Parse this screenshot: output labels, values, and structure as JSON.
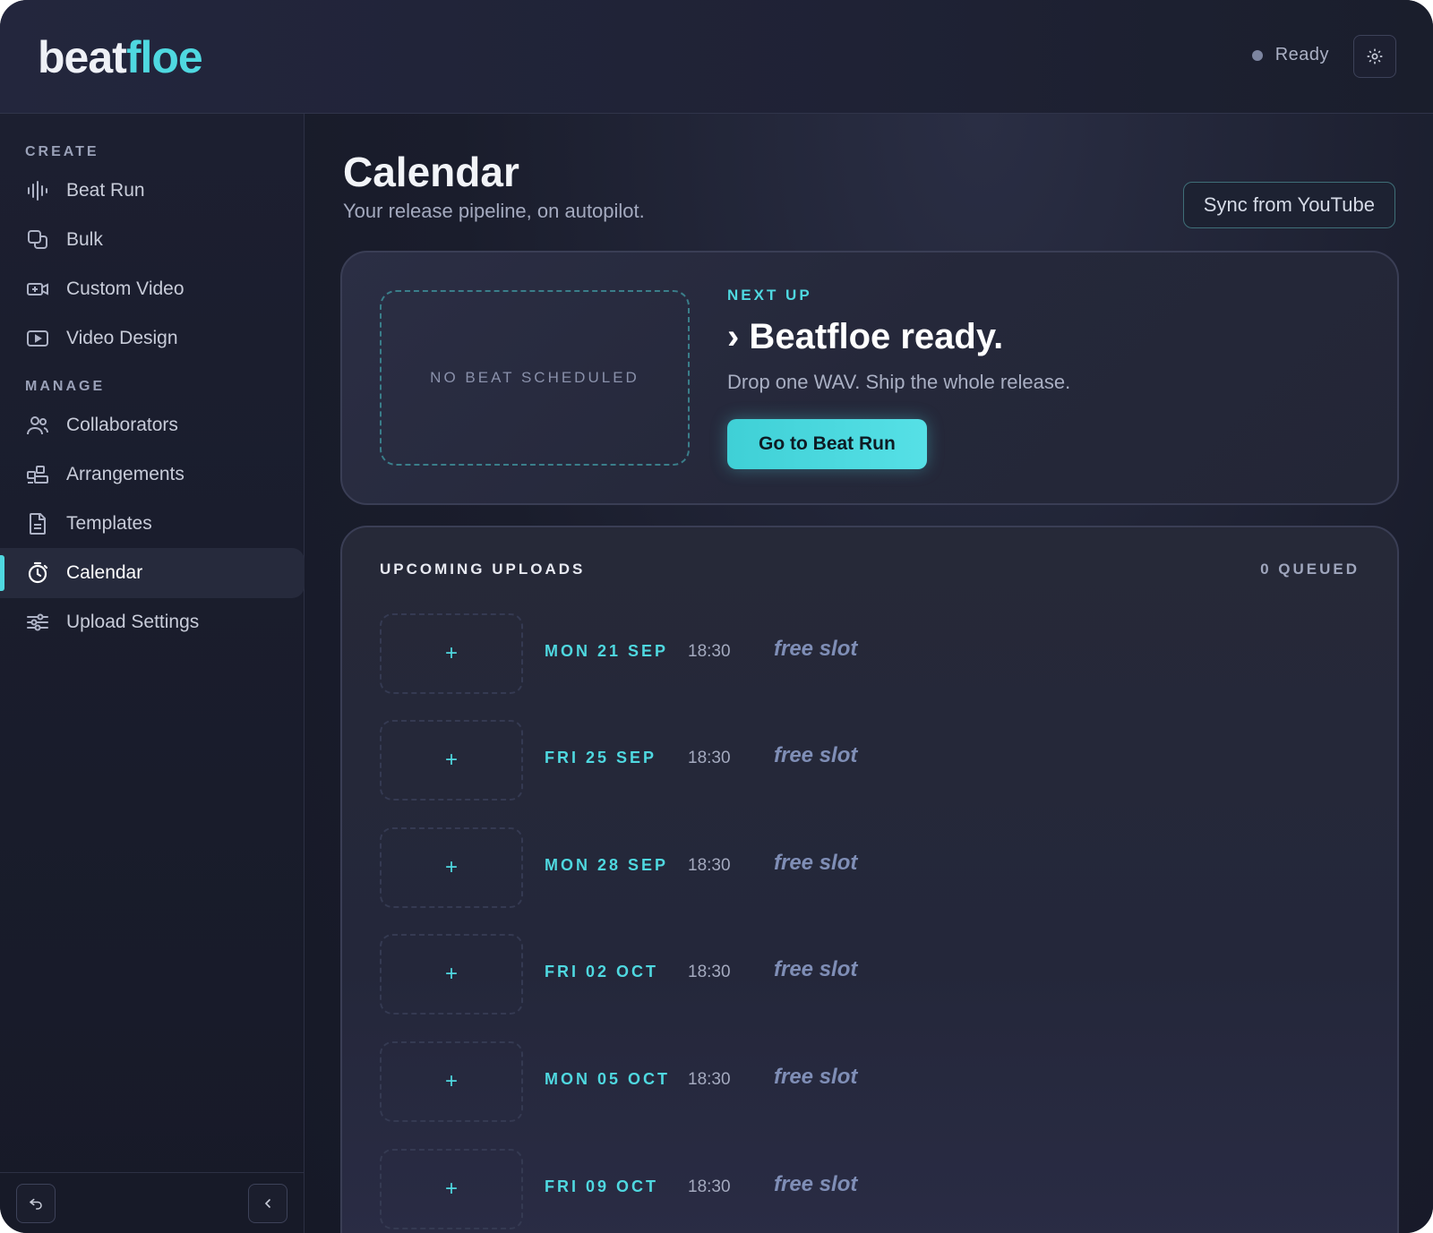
{
  "header": {
    "logo_part1": "beat",
    "logo_part2": "floe",
    "status": "Ready"
  },
  "sidebar": {
    "create_label": "CREATE",
    "manage_label": "MANAGE",
    "create_items": [
      {
        "label": "Beat Run",
        "icon": "waveform-icon"
      },
      {
        "label": "Bulk",
        "icon": "layers-icon"
      },
      {
        "label": "Custom Video",
        "icon": "video-plus-icon"
      },
      {
        "label": "Video Design",
        "icon": "play-screen-icon"
      }
    ],
    "manage_items": [
      {
        "label": "Collaborators",
        "icon": "users-icon"
      },
      {
        "label": "Arrangements",
        "icon": "blocks-icon"
      },
      {
        "label": "Templates",
        "icon": "document-icon"
      },
      {
        "label": "Calendar",
        "icon": "timer-icon",
        "active": true
      },
      {
        "label": "Upload Settings",
        "icon": "sliders-icon"
      }
    ]
  },
  "main": {
    "title": "Calendar",
    "subtitle": "Your release pipeline, on autopilot.",
    "sync_label": "Sync from YouTube",
    "next": {
      "drop_zone": "NO BEAT SCHEDULED",
      "label": "NEXT UP",
      "title": "› Beatfloe ready.",
      "subtitle": "Drop one WAV. Ship the whole release.",
      "cta": "Go to Beat Run"
    },
    "uploads": {
      "title": "UPCOMING UPLOADS",
      "count": "0 QUEUED",
      "add_symbol": "+",
      "slots": [
        {
          "date": "MON 21 SEP",
          "time": "18:30",
          "state": "free slot"
        },
        {
          "date": "FRI 25 SEP",
          "time": "18:30",
          "state": "free slot"
        },
        {
          "date": "MON 28 SEP",
          "time": "18:30",
          "state": "free slot"
        },
        {
          "date": "FRI 02 OCT",
          "time": "18:30",
          "state": "free slot"
        },
        {
          "date": "MON 05 OCT",
          "time": "18:30",
          "state": "free slot"
        },
        {
          "date": "FRI 09 OCT",
          "time": "18:30",
          "state": "free slot"
        }
      ]
    }
  },
  "colors": {
    "accent": "#4fd8e0",
    "background": "#1b1e2e",
    "card": "#2b2e44",
    "muted_text": "#a4aabf",
    "free_slot": "#7f8eb6"
  }
}
